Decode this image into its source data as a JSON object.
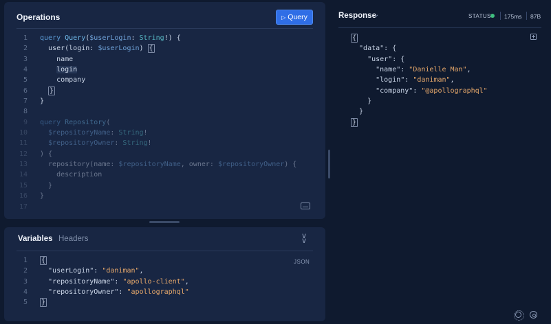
{
  "operations": {
    "title": "Operations",
    "query_button_label": "Query",
    "lines": [
      {
        "n": "1",
        "segs": [
          [
            "kw",
            "query "
          ],
          [
            "fn",
            "Query"
          ],
          [
            "pun",
            "("
          ],
          [
            "var",
            "$userLogin"
          ],
          [
            "pun",
            ": "
          ],
          [
            "type",
            "String"
          ],
          [
            "pun",
            "!) {"
          ]
        ]
      },
      {
        "n": "2",
        "segs": [
          [
            "fld",
            "  user"
          ],
          [
            "pun",
            "("
          ],
          [
            "fld",
            "login"
          ],
          [
            "pun",
            ": "
          ],
          [
            "var",
            "$userLogin"
          ],
          [
            "pun",
            ") "
          ],
          [
            "brk",
            "{"
          ]
        ]
      },
      {
        "n": "3",
        "segs": [
          [
            "fld",
            "    name"
          ]
        ]
      },
      {
        "n": "4",
        "segs": [
          [
            "fld",
            "    "
          ],
          [
            "hl",
            "login"
          ]
        ]
      },
      {
        "n": "5",
        "segs": [
          [
            "fld",
            "    company"
          ]
        ]
      },
      {
        "n": "6",
        "segs": [
          [
            "pun",
            "  "
          ],
          [
            "brk",
            "}"
          ]
        ]
      },
      {
        "n": "7",
        "segs": [
          [
            "pun",
            "}"
          ]
        ]
      },
      {
        "n": "8",
        "segs": []
      },
      {
        "n": "9",
        "dim": true,
        "segs": [
          [
            "kw",
            "query "
          ],
          [
            "fn",
            "Repository"
          ],
          [
            "pun",
            "("
          ]
        ]
      },
      {
        "n": "10",
        "dim": true,
        "segs": [
          [
            "var",
            "  $repositoryName"
          ],
          [
            "pun",
            ": "
          ],
          [
            "type",
            "String"
          ],
          [
            "pun",
            "!"
          ]
        ]
      },
      {
        "n": "11",
        "dim": true,
        "segs": [
          [
            "var",
            "  $repositoryOwner"
          ],
          [
            "pun",
            ": "
          ],
          [
            "type",
            "String"
          ],
          [
            "pun",
            "!"
          ]
        ]
      },
      {
        "n": "12",
        "dim": true,
        "segs": [
          [
            "pun",
            ") {"
          ]
        ]
      },
      {
        "n": "13",
        "dim": true,
        "segs": [
          [
            "fld",
            "  repository"
          ],
          [
            "pun",
            "("
          ],
          [
            "fld",
            "name"
          ],
          [
            "pun",
            ": "
          ],
          [
            "var",
            "$repositoryName"
          ],
          [
            "pun",
            ", "
          ],
          [
            "fld",
            "owner"
          ],
          [
            "pun",
            ": "
          ],
          [
            "var",
            "$repositoryOwner"
          ],
          [
            "pun",
            ") {"
          ]
        ]
      },
      {
        "n": "14",
        "dim": true,
        "segs": [
          [
            "fld",
            "    description"
          ]
        ]
      },
      {
        "n": "15",
        "dim": true,
        "segs": [
          [
            "pun",
            "  }"
          ]
        ]
      },
      {
        "n": "16",
        "dim": true,
        "segs": [
          [
            "pun",
            "}"
          ]
        ]
      },
      {
        "n": "17",
        "dim": true,
        "segs": []
      }
    ]
  },
  "variables": {
    "tab_variables": "Variables",
    "tab_headers": "Headers",
    "json_label": "JSON",
    "lines": [
      {
        "n": "1",
        "segs": [
          [
            "brk",
            "{"
          ]
        ]
      },
      {
        "n": "2",
        "segs": [
          [
            "key",
            "  \"userLogin\""
          ],
          [
            "pun",
            ": "
          ],
          [
            "str",
            "\"daniman\""
          ],
          [
            "pun",
            ","
          ]
        ]
      },
      {
        "n": "3",
        "segs": [
          [
            "key",
            "  \"repositoryName\""
          ],
          [
            "pun",
            ": "
          ],
          [
            "str",
            "\"apollo-client\""
          ],
          [
            "pun",
            ","
          ]
        ]
      },
      {
        "n": "4",
        "segs": [
          [
            "key",
            "  \"repositoryOwner\""
          ],
          [
            "pun",
            ": "
          ],
          [
            "str",
            "\"apollographql\""
          ]
        ]
      },
      {
        "n": "5",
        "segs": [
          [
            "brk",
            "}"
          ]
        ]
      }
    ]
  },
  "response": {
    "title": "Response",
    "status_label": "STATUS",
    "time": "175ms",
    "size": "87B",
    "lines": [
      {
        "segs": [
          [
            "brk",
            "{"
          ]
        ]
      },
      {
        "segs": [
          [
            "key",
            "  \"data\""
          ],
          [
            "pun",
            ": {"
          ]
        ]
      },
      {
        "segs": [
          [
            "key",
            "    \"user\""
          ],
          [
            "pun",
            ": {"
          ]
        ]
      },
      {
        "segs": [
          [
            "key",
            "      \"name\""
          ],
          [
            "pun",
            ": "
          ],
          [
            "str",
            "\"Danielle Man\""
          ],
          [
            "pun",
            ","
          ]
        ]
      },
      {
        "segs": [
          [
            "key",
            "      \"login\""
          ],
          [
            "pun",
            ": "
          ],
          [
            "str",
            "\"daniman\""
          ],
          [
            "pun",
            ","
          ]
        ]
      },
      {
        "segs": [
          [
            "key",
            "      \"company\""
          ],
          [
            "pun",
            ": "
          ],
          [
            "str",
            "\"@apollographql\""
          ]
        ]
      },
      {
        "segs": [
          [
            "pun",
            "    }"
          ]
        ]
      },
      {
        "segs": [
          [
            "pun",
            "  }"
          ]
        ]
      },
      {
        "segs": [
          [
            "brk",
            "}"
          ]
        ]
      }
    ]
  },
  "colors": {
    "accent": "#2f6ee6",
    "status_ok": "#3fbf7f",
    "background": "#0f1a2f",
    "panel": "#182643"
  }
}
